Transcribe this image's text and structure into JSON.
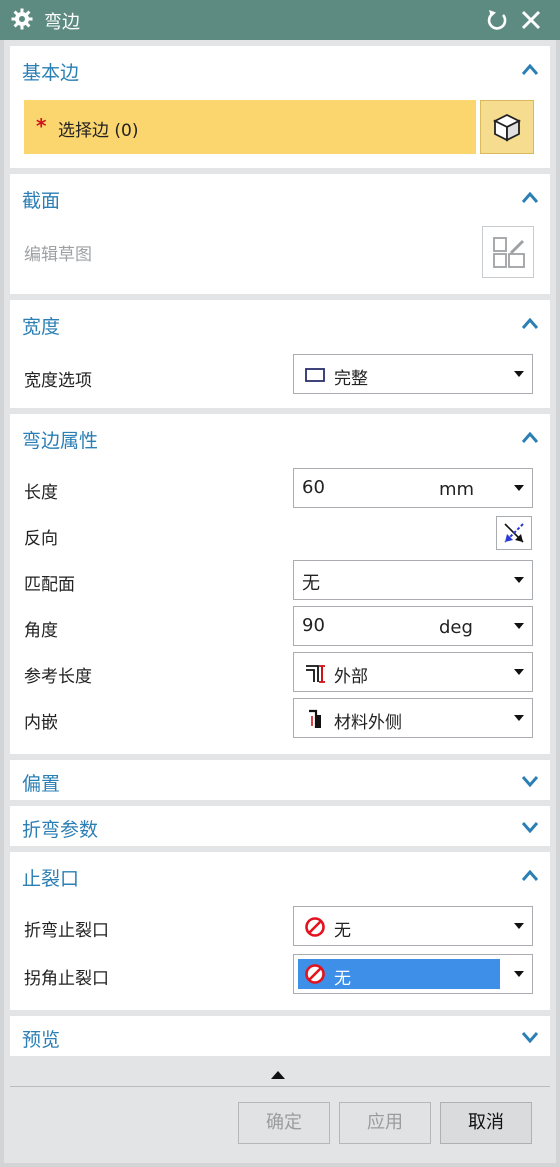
{
  "window": {
    "title": "弯边"
  },
  "sections": {
    "base_edge": {
      "title": "基本边",
      "select_edge": {
        "asterisk": "*",
        "label": "选择边 (0)"
      }
    },
    "section": {
      "title": "截面",
      "edit_sketch_label": "编辑草图"
    },
    "width": {
      "title": "宽度",
      "option_label": "宽度选项",
      "option_value": "完整"
    },
    "flange_props": {
      "title": "弯边属性",
      "length": {
        "label": "长度",
        "value": "60",
        "unit": "mm"
      },
      "reverse": {
        "label": "反向"
      },
      "match_face": {
        "label": "匹配面",
        "value": "无"
      },
      "angle": {
        "label": "角度",
        "value": "90",
        "unit": "deg"
      },
      "ref_length": {
        "label": "参考长度",
        "value": "外部"
      },
      "inset": {
        "label": "内嵌",
        "value": "材料外侧"
      }
    },
    "offset": {
      "title": "偏置"
    },
    "bend_params": {
      "title": "折弯参数"
    },
    "relief": {
      "title": "止裂口",
      "bend_relief": {
        "label": "折弯止裂口",
        "value": "无"
      },
      "corner_relief": {
        "label": "拐角止裂口",
        "value": "无"
      }
    },
    "preview": {
      "title": "预览"
    }
  },
  "buttons": {
    "ok": "确定",
    "apply": "应用",
    "cancel": "取消"
  },
  "colors": {
    "title_bar": "#5d8b82",
    "section_title": "#2b7fb5",
    "selection_highlight": "#fbd66f",
    "dropdown_selected": "#3d8fe8",
    "no_icon_red": "#e3121e"
  }
}
